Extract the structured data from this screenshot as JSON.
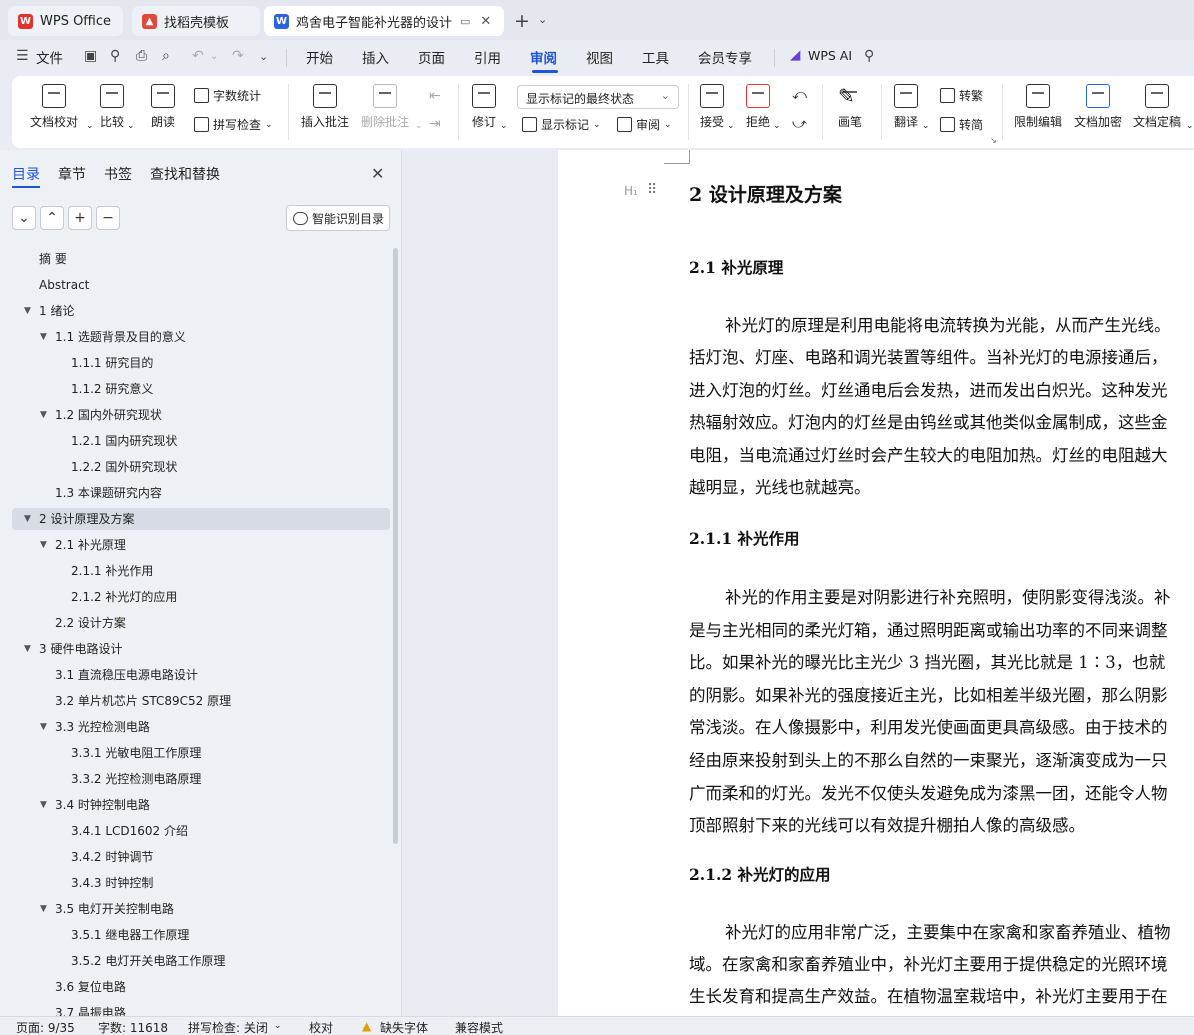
{
  "tabs": [
    {
      "label": "WPS Office",
      "icon": "wps-logo-icon"
    },
    {
      "label": "找稻壳模板",
      "icon": "docer-icon"
    },
    {
      "label": "鸡舍电子智能补光器的设计 毕",
      "icon": "word-doc-icon"
    }
  ],
  "menu": {
    "file": "文件",
    "items": [
      "开始",
      "插入",
      "页面",
      "引用",
      "审阅",
      "视图",
      "工具",
      "会员专享"
    ],
    "active": "审阅",
    "wps_ai": "WPS AI"
  },
  "ribbon": {
    "doc_proofread": "文档校对",
    "compare": "比较",
    "read_aloud": "朗读",
    "word_count": "字数统计",
    "spell_check": "拼写检查",
    "insert_comment": "插入批注",
    "delete_comment": "删除批注",
    "revise": "修订",
    "markup_select": "显示标记的最终状态",
    "show_markup": "显示标记",
    "review": "审阅",
    "accept": "接受",
    "reject": "拒绝",
    "pen": "画笔",
    "translate": "翻译",
    "to_traditional": "转繁",
    "to_simplified": "转简",
    "restrict_edit": "限制编辑",
    "encrypt": "文档加密",
    "finalize": "文档定稿"
  },
  "panel": {
    "tabs": [
      "目录",
      "章节",
      "书签",
      "查找和替换"
    ],
    "smart_toc": "智能识别目录",
    "toc": [
      {
        "label": "摘  要",
        "level": 0,
        "arrow": false
      },
      {
        "label": "Abstract",
        "level": 0,
        "arrow": false
      },
      {
        "label": "1  绪论",
        "level": 0,
        "arrow": true
      },
      {
        "label": "1.1   选题背景及目的意义",
        "level": 1,
        "arrow": true
      },
      {
        "label": "1.1.1  研究目的",
        "level": 2,
        "arrow": false
      },
      {
        "label": "1.1.2  研究意义",
        "level": 2,
        "arrow": false
      },
      {
        "label": "1.2   国内外研究现状",
        "level": 1,
        "arrow": true
      },
      {
        "label": "1.2.1    国内研究现状",
        "level": 2,
        "arrow": false
      },
      {
        "label": "1.2.2    国外研究现状",
        "level": 2,
        "arrow": false
      },
      {
        "label": "1.3   本课题研究内容",
        "level": 1,
        "arrow": false
      },
      {
        "label": "2   设计原理及方案",
        "level": 0,
        "arrow": true,
        "selected": true
      },
      {
        "label": "2.1   补光原理",
        "level": 1,
        "arrow": true
      },
      {
        "label": "2.1.1  补光作用",
        "level": 2,
        "arrow": false
      },
      {
        "label": "2.1.2  补光灯的应用",
        "level": 2,
        "arrow": false
      },
      {
        "label": "2.2   设计方案",
        "level": 1,
        "arrow": false
      },
      {
        "label": "3   硬件电路设计",
        "level": 0,
        "arrow": true
      },
      {
        "label": "3.1   直流稳压电源电路设计",
        "level": 1,
        "arrow": false
      },
      {
        "label": "3.2   单片机芯片 STC89C52 原理",
        "level": 1,
        "arrow": false
      },
      {
        "label": "3.3   光控检测电路",
        "level": 1,
        "arrow": true
      },
      {
        "label": "3.3.1  光敏电阻工作原理",
        "level": 2,
        "arrow": false
      },
      {
        "label": "3.3.2   光控检测电路原理",
        "level": 2,
        "arrow": false
      },
      {
        "label": "3.4   时钟控制电路",
        "level": 1,
        "arrow": true
      },
      {
        "label": "3.4.1 LCD1602 介绍",
        "level": 2,
        "arrow": false
      },
      {
        "label": "3.4.2  时钟调节",
        "level": 2,
        "arrow": false
      },
      {
        "label": "3.4.3  时钟控制",
        "level": 2,
        "arrow": false
      },
      {
        "label": "3.5   电灯开关控制电路",
        "level": 1,
        "arrow": true
      },
      {
        "label": "3.5.1  继电器工作原理",
        "level": 2,
        "arrow": false
      },
      {
        "label": "3.5.2  电灯开关电路工作原理",
        "level": 2,
        "arrow": false
      },
      {
        "label": "3.6   复位电路",
        "level": 1,
        "arrow": false
      },
      {
        "label": "3.7   晶振电路",
        "level": 1,
        "arrow": false
      }
    ]
  },
  "document": {
    "h1": "2   设计原理及方案",
    "h1_marker": "H₁",
    "h2": "2.1   补光原理",
    "para1": [
      "补光灯的原理是利用电能将电流转换为光能，从而产生光线。",
      "括灯泡、灯座、电路和调光装置等组件。当补光灯的电源接通后，",
      "进入灯泡的灯丝。灯丝通电后会发热，进而发出白炽光。这种发光",
      "热辐射效应。灯泡内的灯丝是由钨丝或其他类似金属制成，这些金",
      "电阻，当电流通过灯丝时会产生较大的电阻加热。灯丝的电阻越大",
      "越明显，光线也就越亮。"
    ],
    "h3a": "2.1.1  补光作用",
    "para2": [
      "补光的作用主要是对阴影进行补充照明，使阴影变得浅淡。补",
      "是与主光相同的柔光灯箱，通过照明距离或输出功率的不同来调整",
      "比。如果补光的曝光比主光少 3 挡光圈，其光比就是 1∶3，也就",
      "的阴影。如果补光的强度接近主光，比如相差半级光圈，那么阴影",
      "常浅淡。在人像摄影中，利用发光使画面更具高级感。由于技术的",
      "经由原来投射到头上的不那么自然的一束聚光，逐渐演变成为一只",
      "广而柔和的灯光。发光不仅使头发避免成为漆黑一团，还能令人物",
      "顶部照射下来的光线可以有效提升棚拍人像的高级感。"
    ],
    "h3b": "2.1.2  补光灯的应用",
    "para3": [
      "补光灯的应用非常广泛，主要集中在家禽和家畜养殖业、植物",
      "域。在家禽和家畜养殖业中，补光灯主要用于提供稳定的光照环境",
      "生长发育和提高生产效益。在植物温室栽培中，补光灯主要用于在"
    ]
  },
  "status": {
    "page": "页面: 9/35",
    "words": "字数: 11618",
    "spell": "拼写检查: 关闭",
    "proof": "校对",
    "missing_font": "缺失字体",
    "compat": "兼容模式"
  }
}
